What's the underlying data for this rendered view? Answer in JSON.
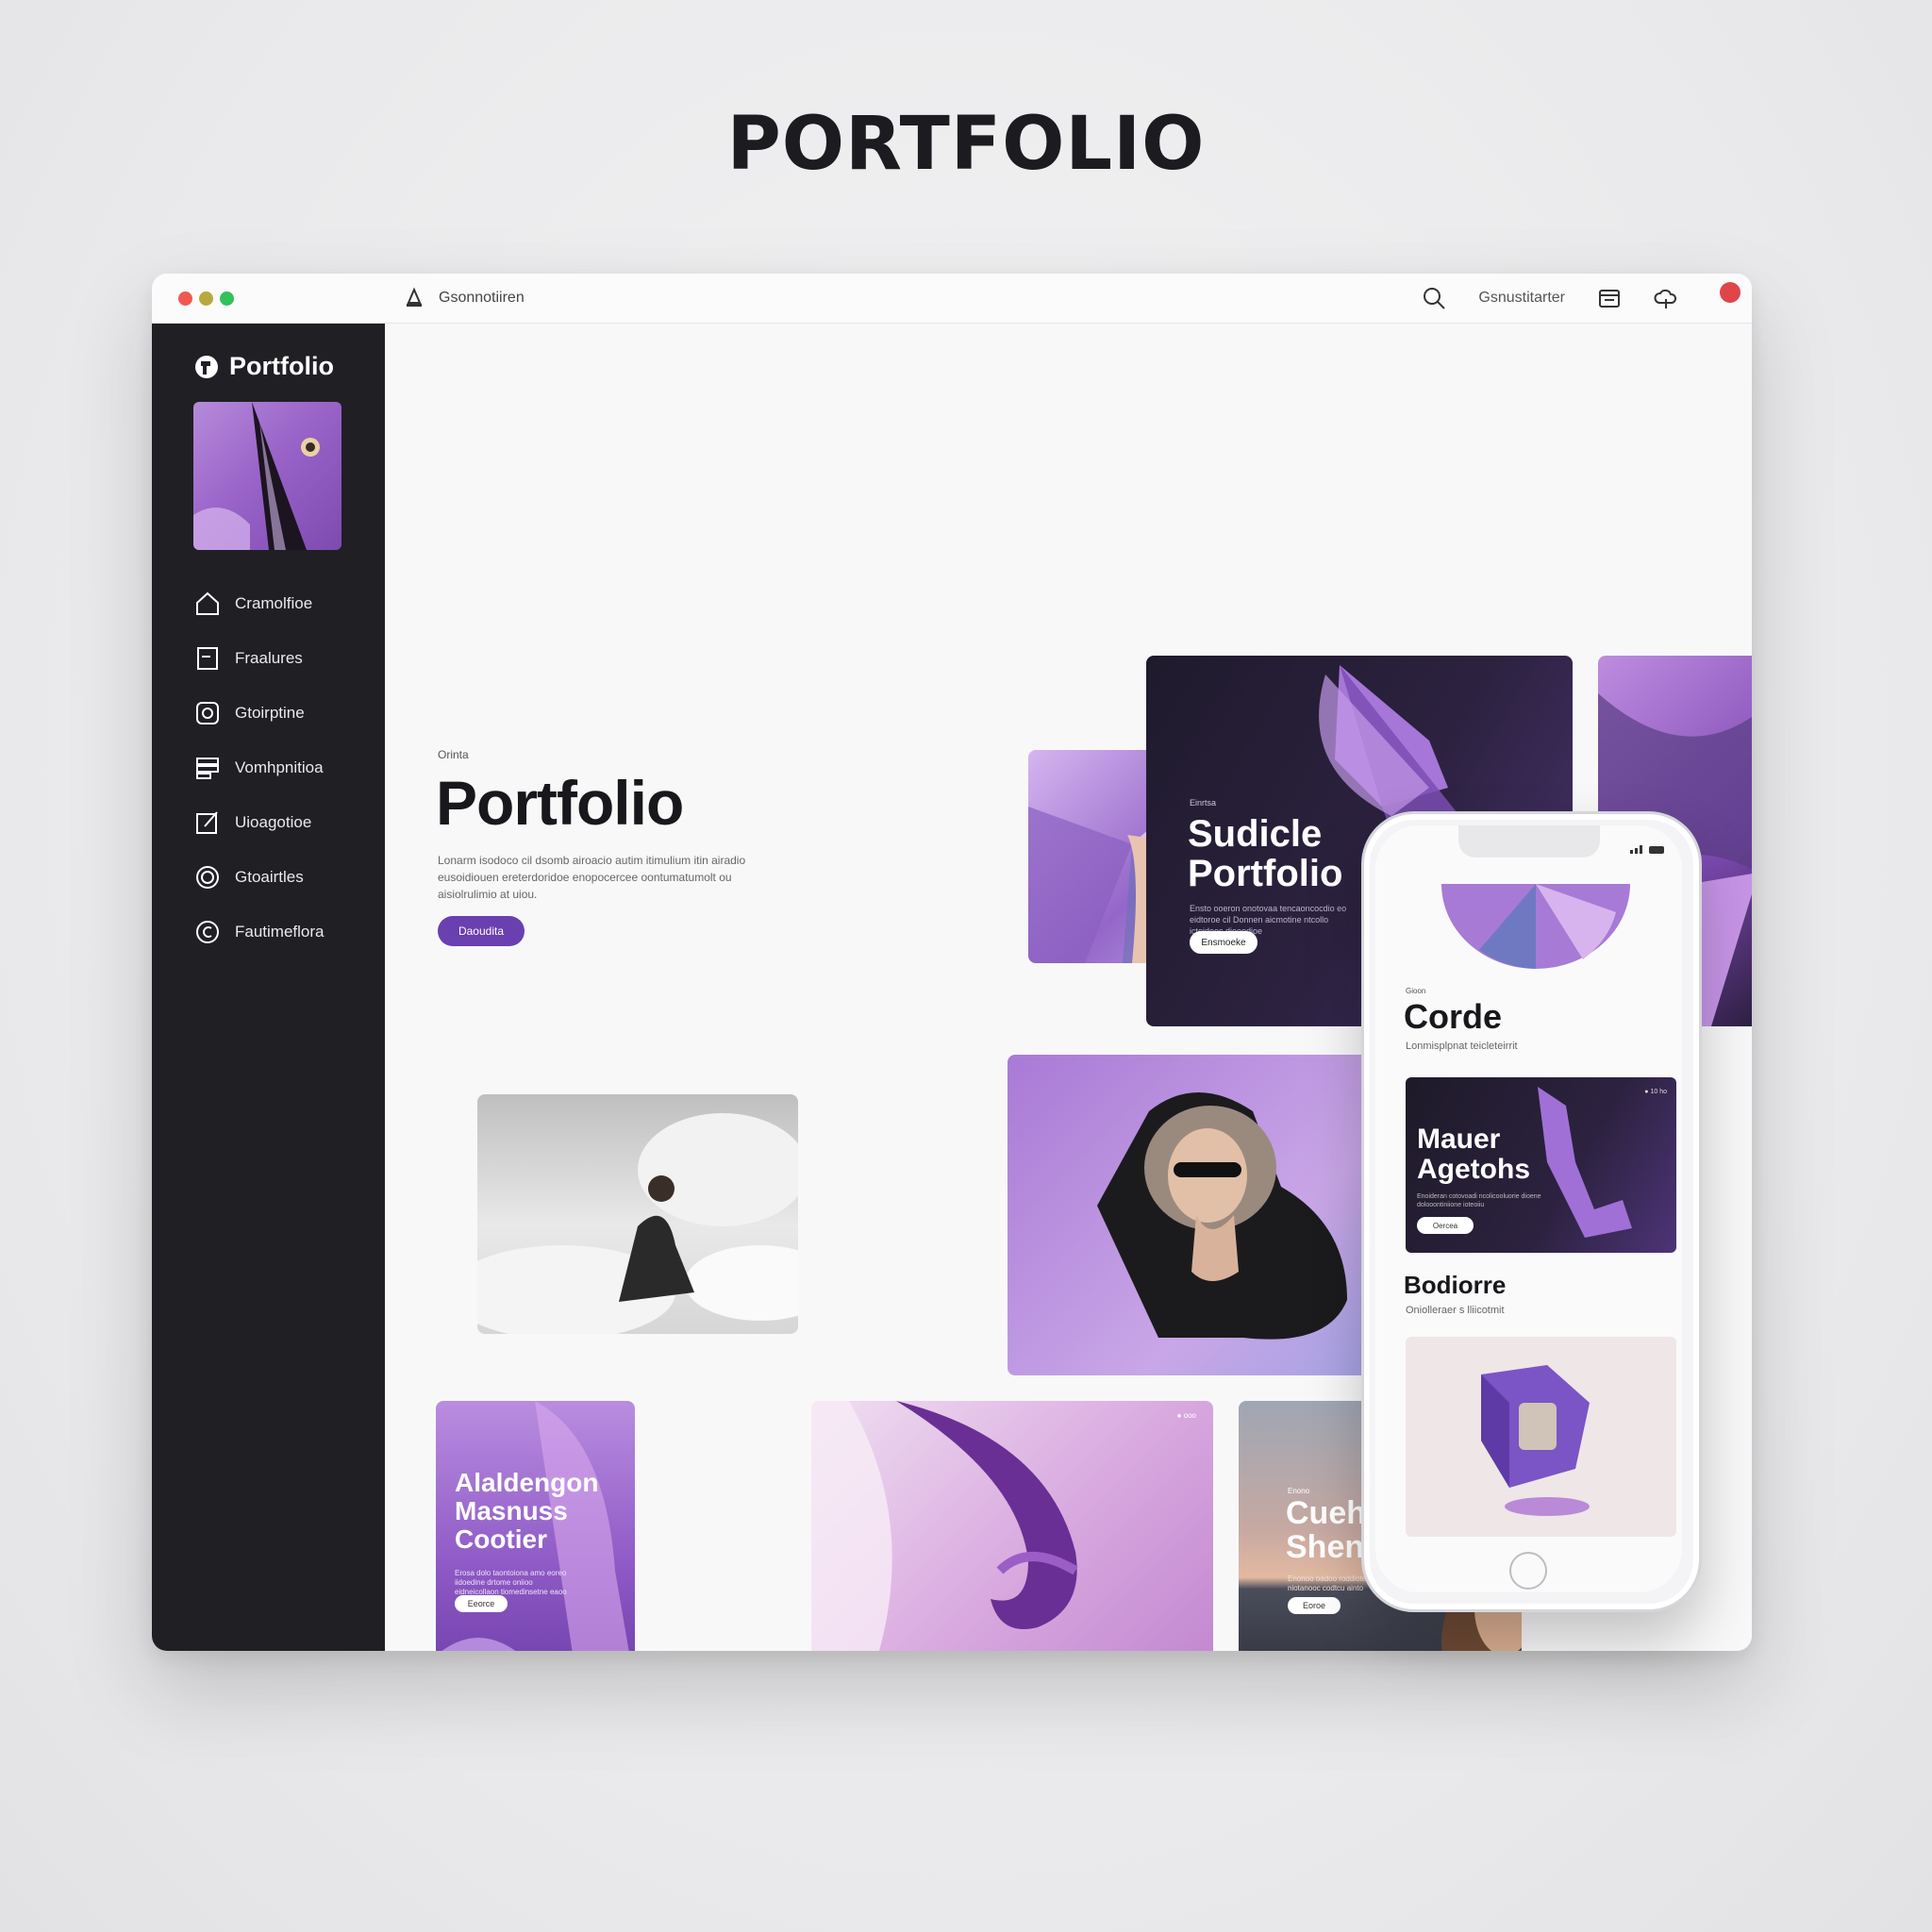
{
  "page_heading": "PORTFOLIO",
  "titlebar": {
    "app_label": "Gsonnotiiren",
    "right_label": "Gsnustitarter",
    "notification_count": ""
  },
  "sidebar": {
    "brand": "Portfolio",
    "items": [
      {
        "label": "Cramolfioe",
        "icon": "home-icon"
      },
      {
        "label": "Fraalures",
        "icon": "document-icon"
      },
      {
        "label": "Gtoirptine",
        "icon": "camera-icon"
      },
      {
        "label": "Vomhpnitioa",
        "icon": "layers-icon"
      },
      {
        "label": "Uioagotioe",
        "icon": "edit-icon"
      },
      {
        "label": "Gtoairtles",
        "icon": "circle-icon"
      },
      {
        "label": "Fautimeflora",
        "icon": "copyright-icon"
      }
    ]
  },
  "hero": {
    "eyebrow": "Orinta",
    "title": "Portfolio",
    "description": "Lonarm isodoco cil dsomb airoacio autim itimulium itin airadio eusoidiouen ereterdoridoe enopocercee oontumatumolt ou aisiolrulimio at uiou.",
    "button": "Daoudita"
  },
  "feature_card": {
    "eyebrow": "Einrtsa",
    "title_line1": "Sudicle",
    "title_line2": "Portfolio",
    "description": "Ensto ooeron onotovaa tencaoncocdio eo eidtoroe cil Donnen aicmotine ntcollo icteidooc dioeodioe",
    "button": "Ensmoeke"
  },
  "purple_card": {
    "title_line1": "Alaldengon",
    "title_line2": "Masnuss",
    "title_line3": "Cootier",
    "description": "Erosa dolo taontoiona amo eoreo iidoedine drtome oniioo eidneicollaon tiomedinsetne eaoo",
    "button": "Eeorce"
  },
  "sunset_card": {
    "eyebrow": "Enono",
    "title_line1": "Cuehter",
    "title_line2": "Shenties",
    "description": "Enonoo oadoo roddiotenoe niotanooc codtcu ainto",
    "button": "Eoroe"
  },
  "pink_card": {
    "tag": "● ooo"
  },
  "phone": {
    "eyebrow": "Gioon",
    "title": "Corde",
    "subtitle": "Lonmisplpnat teicleteirrit",
    "card_title_line1": "Mauer",
    "card_title_line2": "Agetohs",
    "card_tag": "● 10 ho",
    "card_desc": "Enoideran cotovoadi ncolicooluorie dioene dolooontiniione ioteoiiu",
    "card_button": "Oercea",
    "section_title": "Bodiorre",
    "section_subtitle": "Oniolleraer s lliicotmit"
  },
  "colors": {
    "accent": "#6a3fb0",
    "sidebar_bg": "#1f1f24",
    "dark_card": "#231d33"
  }
}
